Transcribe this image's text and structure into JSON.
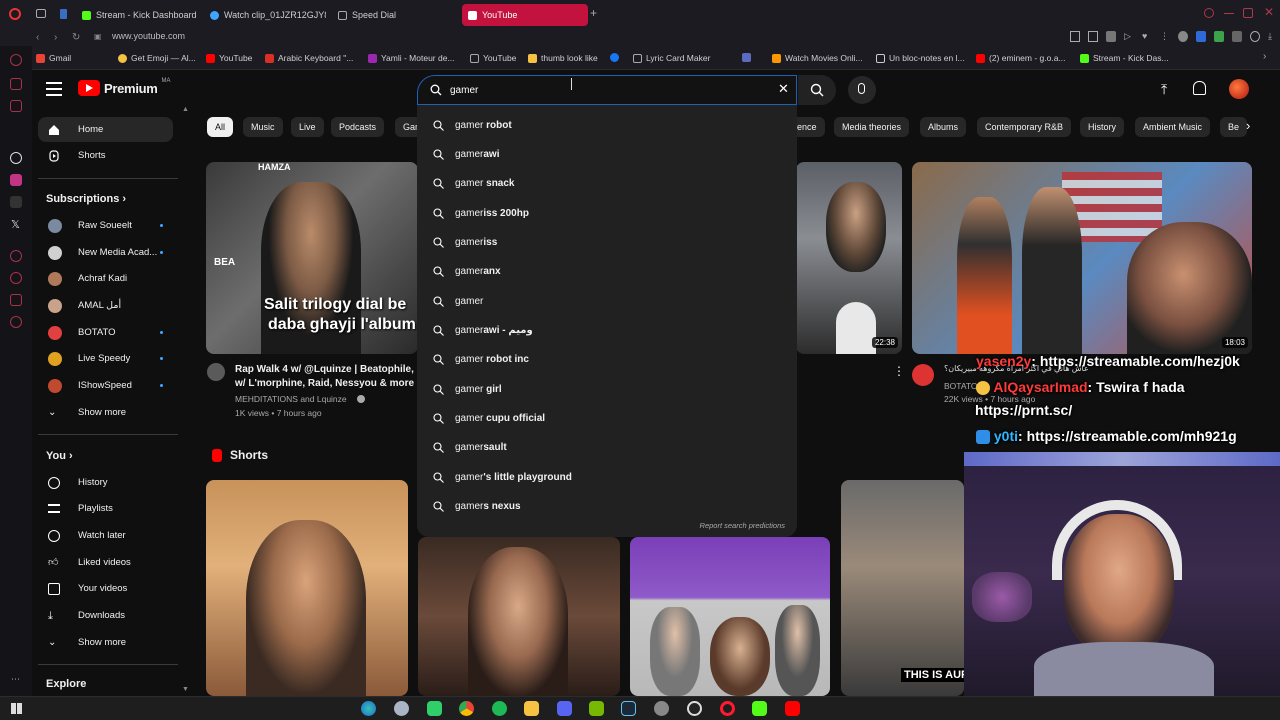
{
  "browser": {
    "tabs": [
      {
        "label": "Stream - Kick Dashboard",
        "color": "#53fc18"
      },
      {
        "label": "Watch clip_01JZR12GJY8...",
        "color": "#3ea6ff"
      },
      {
        "label": "Speed Dial",
        "color": "#888888"
      },
      {
        "label": "YouTube",
        "color": "#ff0000"
      }
    ],
    "url": "www.youtube.com",
    "bookmarks": [
      {
        "label": "Gmail",
        "color": "#ea4335"
      },
      {
        "label": "Get Emoji — Al...",
        "color": "#f5c242"
      },
      {
        "label": "YouTube",
        "color": "#ff0000"
      },
      {
        "label": "Arabic Keyboard \"...",
        "color": "#d93025"
      },
      {
        "label": "Yamli - Moteur de...",
        "color": "#9c27b0"
      },
      {
        "label": "YouTube",
        "color": "#aaaaaa"
      },
      {
        "label": "thumb look like",
        "color": "#f5c242"
      },
      {
        "label": "",
        "color": "#1877f2"
      },
      {
        "label": "Lyric Card Maker",
        "color": "#aaaaaa"
      },
      {
        "label": "",
        "color": "#5c6bc0"
      },
      {
        "label": "Watch Movies Onli...",
        "color": "#ff9800"
      },
      {
        "label": "Un bloc-notes en l...",
        "color": "#cccccc"
      },
      {
        "label": "(2) eminem - g.o.a...",
        "color": "#ff0000"
      },
      {
        "label": "Stream - Kick Das...",
        "color": "#53fc18"
      }
    ]
  },
  "youtube": {
    "brand": "Premium",
    "region": "MA",
    "search": {
      "value": "gamer",
      "suggestions": [
        {
          "bold": "gamer",
          "rest": " robot"
        },
        {
          "bold": "gamer",
          "rest": "awi"
        },
        {
          "bold": "gamer",
          "rest": " snack"
        },
        {
          "bold": "gamer",
          "rest": "iss 200hp"
        },
        {
          "bold": "gamer",
          "rest": "iss"
        },
        {
          "bold": "gamer",
          "rest": "anx"
        },
        {
          "bold": "gamer",
          "rest": ""
        },
        {
          "bold": "gamer",
          "rest": "awi - وميم"
        },
        {
          "bold": "gamer",
          "rest": " robot inc"
        },
        {
          "bold": "gamer",
          "rest": " girl"
        },
        {
          "bold": "gamer",
          "rest": " cupu official"
        },
        {
          "bold": "gamer",
          "rest": "sault"
        },
        {
          "bold": "gamer",
          "rest": "'s little playground"
        },
        {
          "bold": "gamer",
          "rest": "s nexus"
        }
      ],
      "report": "Report search predictions"
    },
    "chips": [
      "All",
      "Music",
      "Live",
      "Podcasts",
      "Gar",
      "gence",
      "Media theories",
      "Albums",
      "Contemporary R&B",
      "History",
      "Ambient Music",
      "Be"
    ],
    "sidebar": {
      "main": [
        {
          "label": "Home"
        },
        {
          "label": "Shorts"
        }
      ],
      "subscriptions_title": "Subscriptions",
      "subscriptions": [
        {
          "label": "Raw Soueelt",
          "color": "#7a8aa0"
        },
        {
          "label": "New Media Acad...",
          "color": "#d0d0d0"
        },
        {
          "label": "Achraf Kadi",
          "color": "#b07a5a"
        },
        {
          "label": "AMAL أمل",
          "color": "#c9a28a"
        },
        {
          "label": "BOTATO",
          "color": "#e04040"
        },
        {
          "label": "Live Speedy",
          "color": "#e0a020"
        },
        {
          "label": "IShowSpeed",
          "color": "#c04a30"
        }
      ],
      "show_more": "Show more",
      "you_title": "You",
      "you": [
        {
          "label": "History"
        },
        {
          "label": "Playlists"
        },
        {
          "label": "Watch later"
        },
        {
          "label": "Liked videos"
        },
        {
          "label": "Your videos"
        },
        {
          "label": "Downloads"
        }
      ],
      "show_more_2": "Show more",
      "explore_title": "Explore"
    },
    "videos": [
      {
        "thumb_caption_1": "HAMZA",
        "thumb_caption_2": "Salit trilogy dial be",
        "thumb_caption_3": "daba ghayji l'album",
        "thumb_caption_4": "BEA",
        "title_1": "Rap Walk 4 w/ @Lquinze  | Beatophile,",
        "title_2": "w/ L'morphine, Raid, Nessyou & more",
        "channel": "MEHDITATIONS and Lquinze",
        "meta": "1K views • 7 hours ago"
      },
      {
        "duration": "22:38"
      },
      {
        "duration": "18:03",
        "channel": "BOTATO",
        "meta": "22K views • 7 hours ago"
      }
    ],
    "shorts_title": "Shorts",
    "short_caption": "THIS IS AUF"
  },
  "chat_overlay": [
    {
      "user": "yasen2y",
      "msg": ": https://streamable.com/hezj0k"
    },
    {
      "user": "AlQaysarImad",
      "msg": ": Tswira f hada"
    },
    {
      "user": "",
      "msg": "https://prnt.sc/"
    },
    {
      "user": "y0ti",
      "msg": ": https://streamable.com/mh921g"
    }
  ],
  "arabic_overlay": "عاش هاني في اكثر امراة مكروهه مبيريكان؟",
  "colors": {
    "accent_red": "#ff0000",
    "search_focus": "#1c62b9",
    "chip_bg": "#272727",
    "bg": "#0f0f0f"
  }
}
